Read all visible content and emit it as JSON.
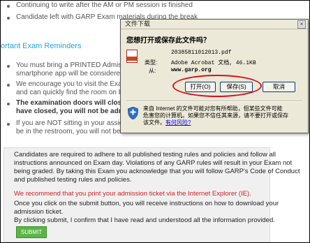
{
  "background": {
    "lines": [
      "Continuing to write after the AM or PM session is finished",
      "Candidate left with GARP Exam materials during the break"
    ],
    "section_title": "ortant Exam Reminders",
    "bullets": [
      {
        "line1": "You must bring a PRINTED Admission",
        "line2": "smartphone app will be considered or a"
      },
      {
        "line1": "We encourage you to visit the Exam s",
        "line2": "and can quickly find the room on Exam D"
      },
      {
        "line1": "The examination doors will close after",
        "line2": "have closed, you will not be admitte"
      },
      {
        "line1": "If you are NOT sitting in your assigned",
        "line2": "be in the restroom, you will not be re-a"
      }
    ]
  },
  "notice": {
    "paragraph1": [
      "Candidates are required to adhere to all published testing rules and policies and follow all",
      "instructions announced on Exam day. Violations of any GARP rules will result in your Exam not",
      "being graded. By taking this Exam you acknowledge that you will follow GARP's Code of Conduct",
      "and published testing rules and policies."
    ],
    "recommend": "We recommend that you print your admission ticket via the Internet Explorer (IE).",
    "paragraph2": [
      "Once you click on the submit button, you will receive instructions on how to download your",
      "admission ticket."
    ],
    "confirm": "By clicking submit, I confirm that I have read and understood all the information provided.",
    "submit_label": "SUBMIT"
  },
  "dialog": {
    "title": "文件下载",
    "close_label": "×",
    "prompt": "您想打开或保存此文件吗？",
    "file_name": "20385811012013.pdf",
    "type_label": "类型:",
    "type_value": "Adobe Acrobat 文档, 46.1KB",
    "from_label": "从:",
    "from_value": "www.garp.org",
    "open_button": "打开(O)",
    "save_button": "保存(S)",
    "cancel_button": "取消",
    "info_lines": [
      "来自 Internet 的文件可能对您有所帮助，但某些文件可能",
      "危害您的计算机。如果您不信任其来源，请不要打开或保存"
    ],
    "info_tail": "该文件。",
    "risk_link": "有何风险?"
  },
  "colors": {
    "section_title": "#2aa0d8",
    "recommend": "#d02020",
    "submit_bg": "#5ab545",
    "highlight_oval": "#d8101a"
  }
}
